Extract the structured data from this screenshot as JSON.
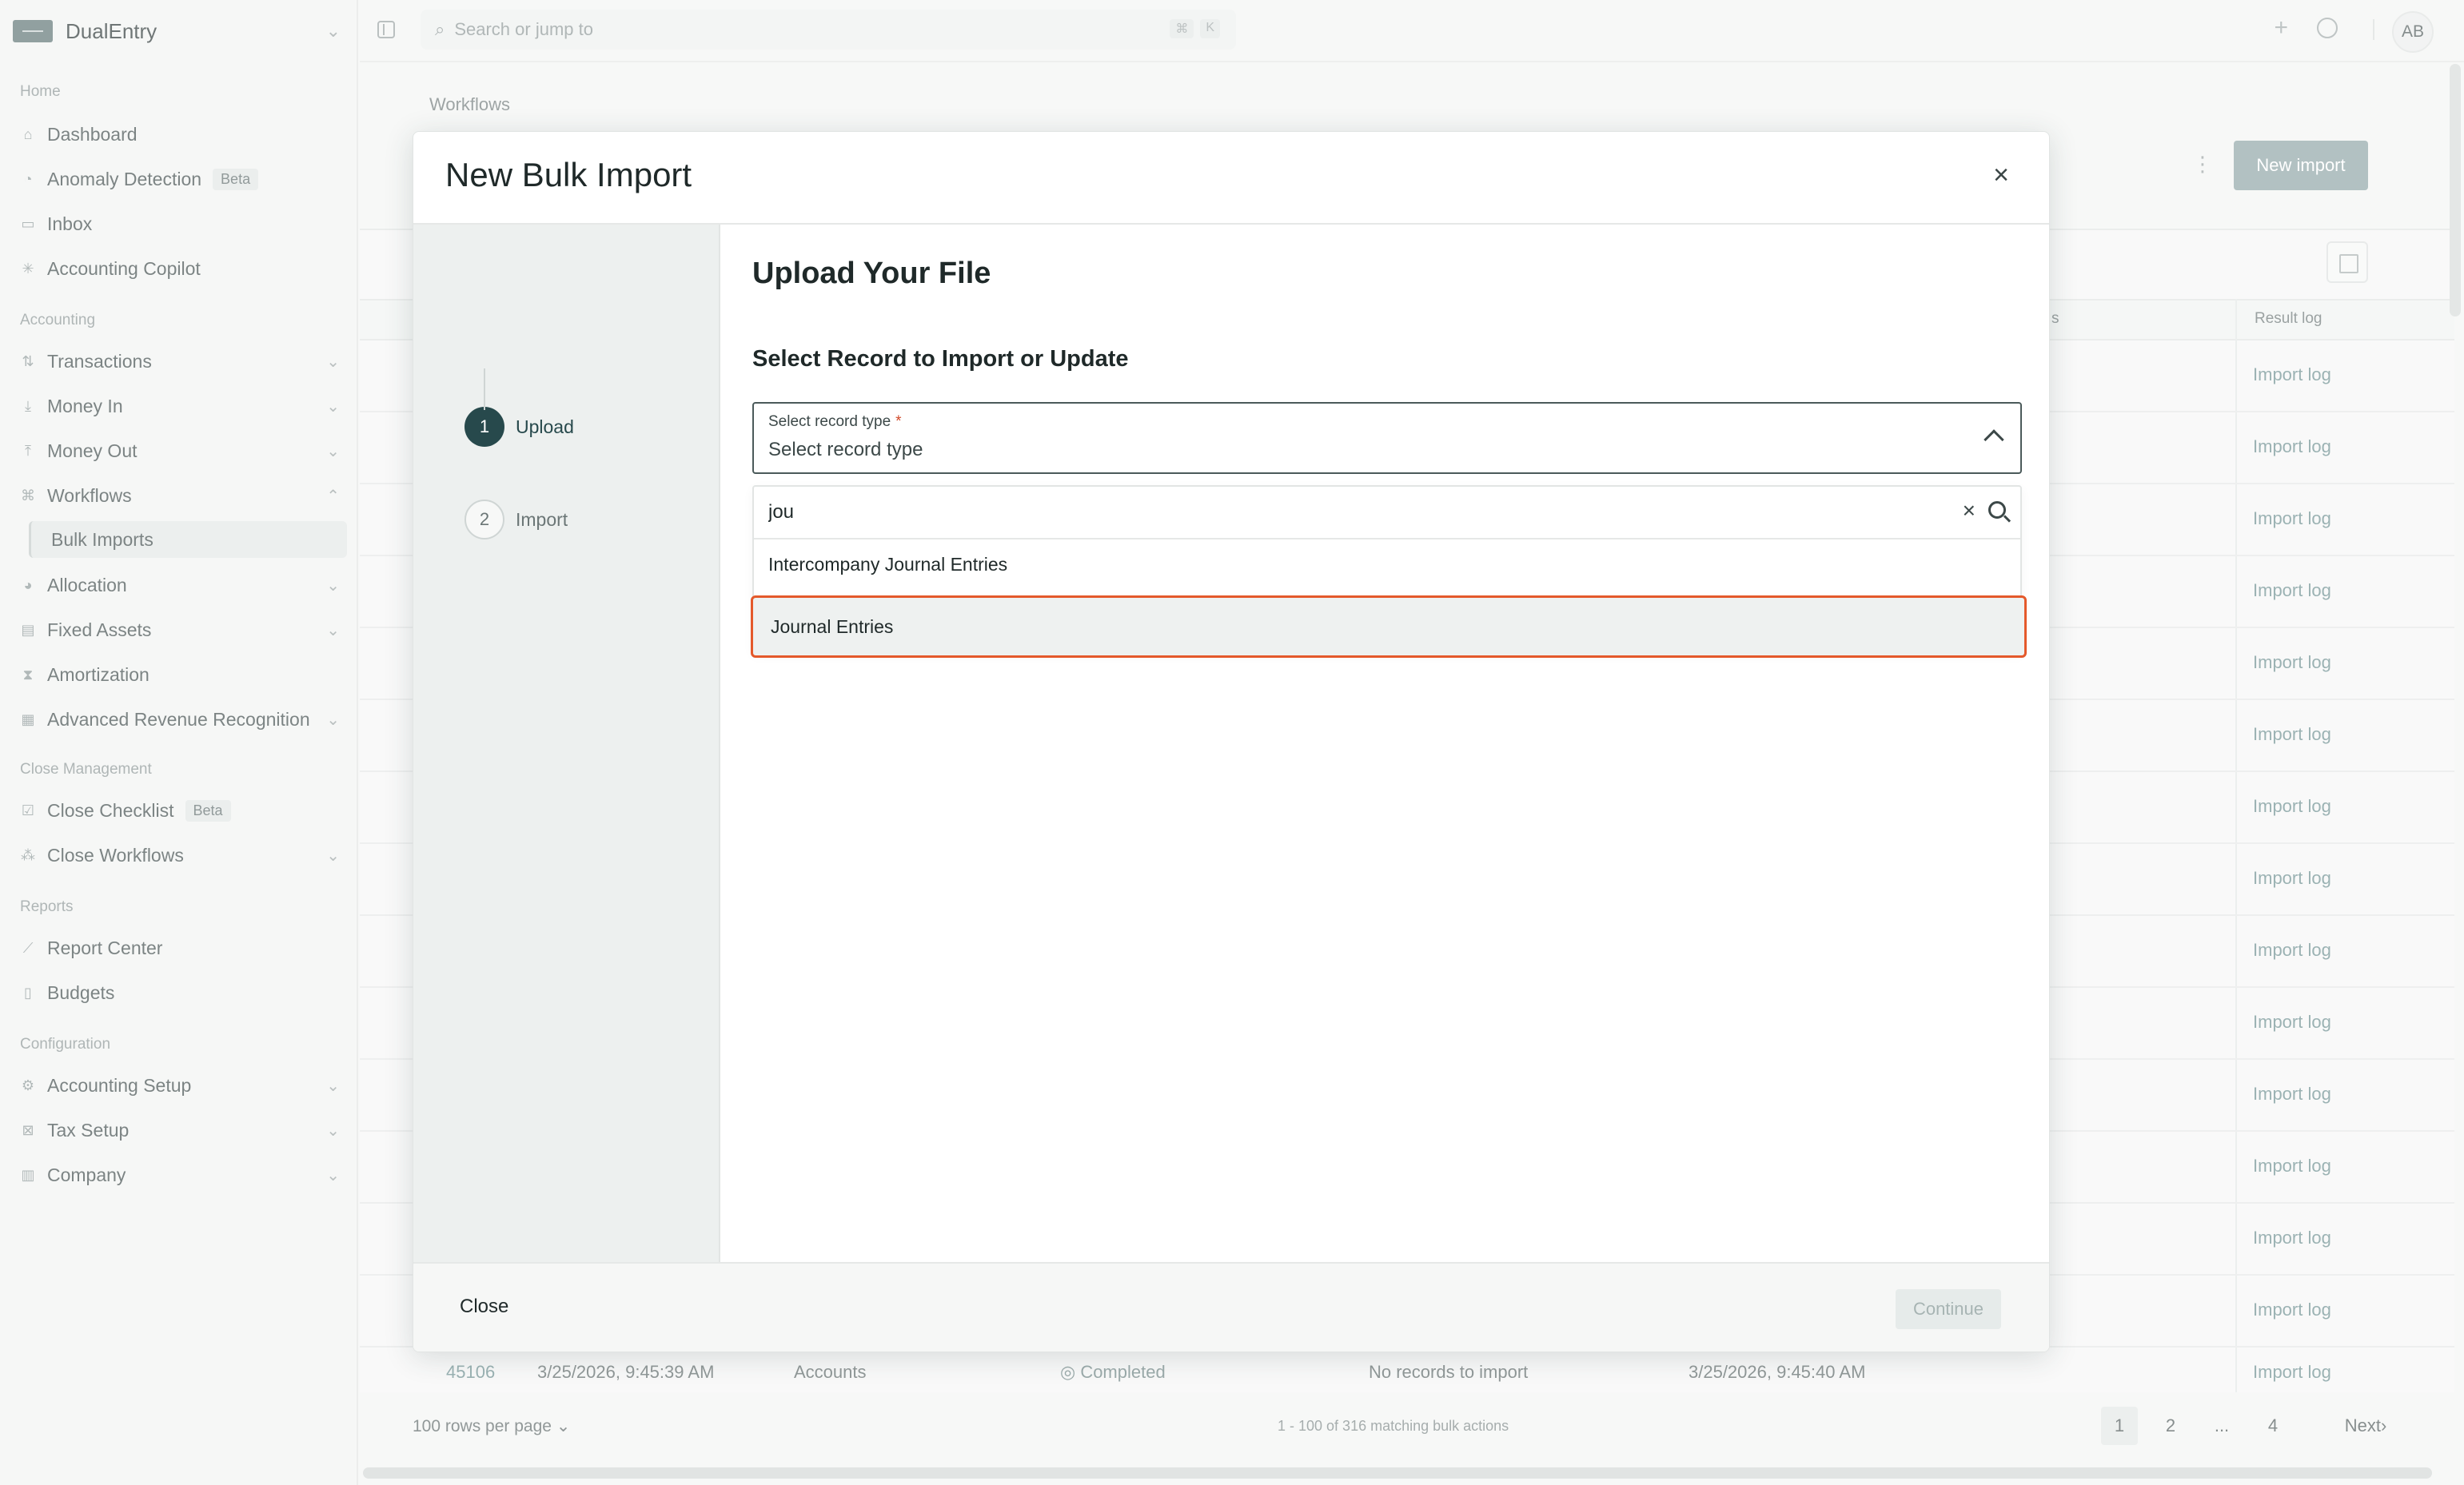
{
  "app": {
    "name": "DualEntry"
  },
  "sidebar": {
    "sections": {
      "home": "Home",
      "accounting": "Accounting",
      "close": "Close Management",
      "reports": "Reports",
      "config": "Configuration"
    },
    "items": {
      "dashboard": "Dashboard",
      "anomaly": "Anomaly Detection",
      "anomaly_badge": "Beta",
      "inbox": "Inbox",
      "copilot": "Accounting Copilot",
      "transactions": "Transactions",
      "money_in": "Money In",
      "money_out": "Money Out",
      "workflows": "Workflows",
      "bulk_imports": "Bulk Imports",
      "allocation": "Allocation",
      "fixed_assets": "Fixed Assets",
      "amortization": "Amortization",
      "arr": "Advanced Revenue Recognition",
      "close_checklist": "Close Checklist",
      "close_checklist_badge": "Beta",
      "close_workflows": "Close Workflows",
      "report_center": "Report Center",
      "budgets": "Budgets",
      "accounting_setup": "Accounting Setup",
      "tax_setup": "Tax Setup",
      "company": "Company"
    }
  },
  "topbar": {
    "search_placeholder": "Search or jump to",
    "shortcut": [
      "⌘",
      "K"
    ],
    "avatar": "AB"
  },
  "background": {
    "breadcrumb": "Workflows",
    "new_import": "New import",
    "col_status_partial": "s",
    "col_result_log": "Result log",
    "import_log": "Import log",
    "last_row": {
      "id": "45106",
      "date": "3/25/2026, 9:45:39 AM",
      "record": "Accounts",
      "status": "Completed",
      "message": "No records to import",
      "finished": "3/25/2026, 9:45:40 AM",
      "log": "Import log"
    },
    "rows_per_page": "100 rows per page",
    "matching": "1 - 100 of 316 matching bulk actions",
    "pages": [
      "1",
      "2",
      "...",
      "4"
    ],
    "next": "Next"
  },
  "modal": {
    "title": "New Bulk Import",
    "steps": [
      {
        "num": "1",
        "label": "Upload"
      },
      {
        "num": "2",
        "label": "Import"
      }
    ],
    "heading": "Upload Your File",
    "subheading": "Select Record to Import or Update",
    "record_type": {
      "label": "Select record type",
      "required_mark": "*",
      "value": "Select record type"
    },
    "search_value": "jou",
    "options": [
      "Intercompany Journal Entries",
      "Journal Entries"
    ],
    "close_btn": "Close",
    "continue_btn": "Continue"
  }
}
